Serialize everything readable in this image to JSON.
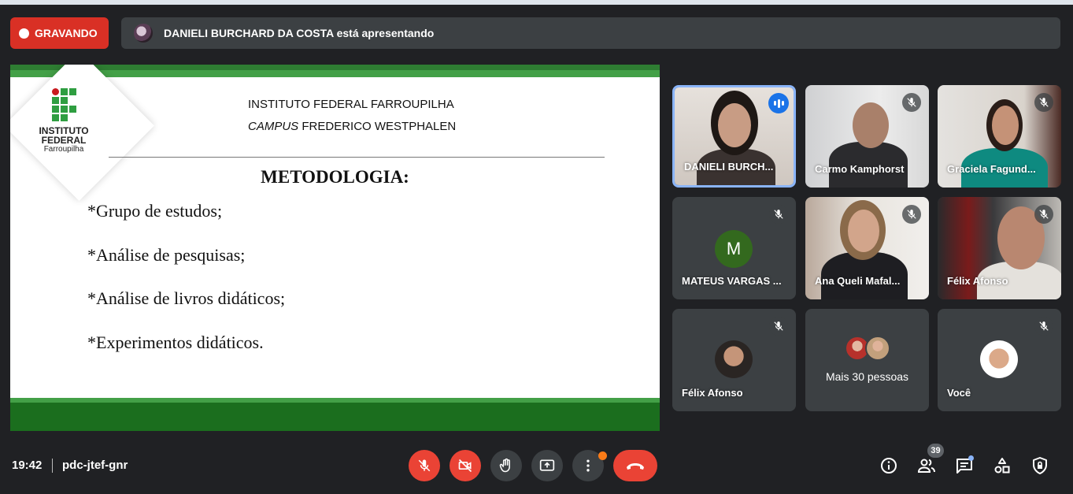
{
  "recording": {
    "label": "GRAVANDO"
  },
  "presenting": {
    "text": "DANIELI BURCHARD DA COSTA está apresentando"
  },
  "slide": {
    "logo_line1": "INSTITUTO",
    "logo_line2": "FEDERAL",
    "logo_line3": "Farroupilha",
    "header_line1": "INSTITUTO FEDERAL FARROUPILHA",
    "header_line2_italic": "CAMPUS",
    "header_line2_rest": " FREDERICO WESTPHALEN",
    "title": "METODOLOGIA:",
    "bullets": [
      "*Grupo de estudos;",
      "*Análise de pesquisas;",
      "*Análise de livros didáticos;",
      "*Experimentos didáticos."
    ]
  },
  "participants": [
    {
      "name": "DANIELI BURCH...",
      "state": "speaking"
    },
    {
      "name": "Carmo Kamphorst",
      "state": "muted"
    },
    {
      "name": "Graciela Fagund...",
      "state": "muted"
    },
    {
      "name": "MATEUS VARGAS ...",
      "state": "muted",
      "initial": "M"
    },
    {
      "name": "Ana Queli Mafal...",
      "state": "muted"
    },
    {
      "name": "Félix Afonso",
      "state": "muted"
    },
    {
      "name": "Félix Afonso",
      "state": "muted"
    },
    {
      "name": "Mais 30 pessoas",
      "state": "overflow"
    },
    {
      "name": "Você",
      "state": "muted"
    }
  ],
  "bottom": {
    "time": "19:42",
    "meeting_code": "pdc-jtef-gnr",
    "participant_count": "39"
  },
  "colors": {
    "background": "#202124",
    "tile": "#3c4043",
    "danger": "#ea4335",
    "speaking": "#1a73e8",
    "recording": "#d93025"
  }
}
